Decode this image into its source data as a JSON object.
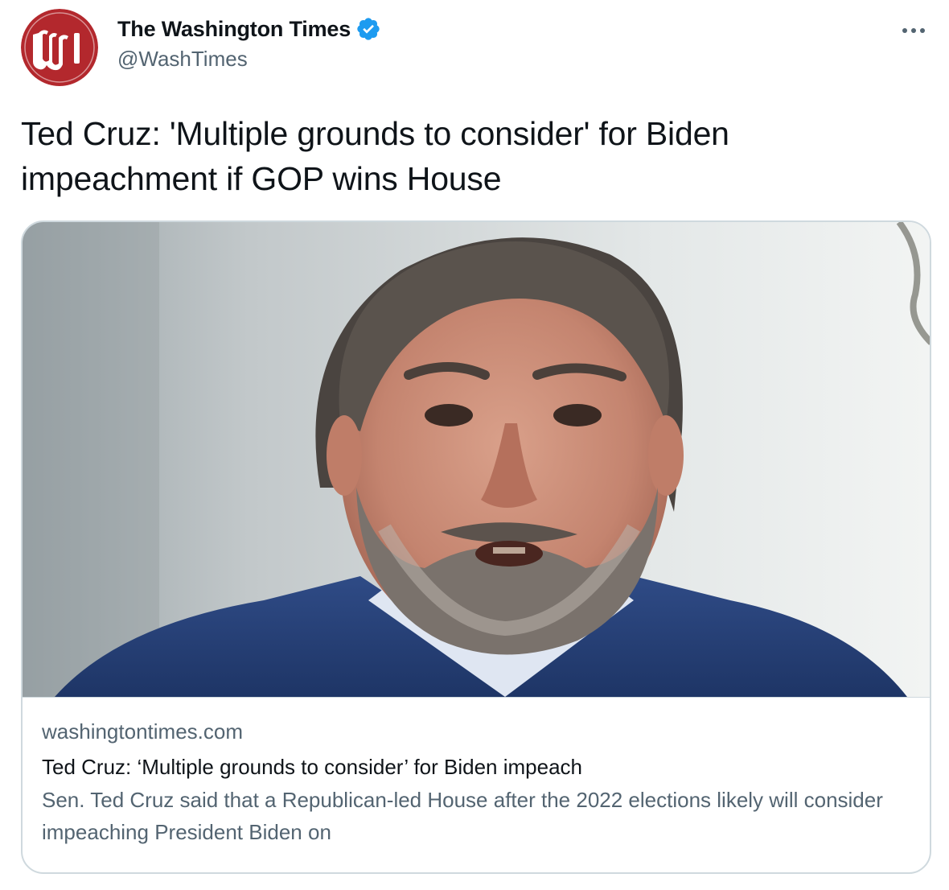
{
  "author": {
    "display_name": "The Washington Times",
    "handle": "@WashTimes",
    "verified": true,
    "avatar_icon": "washington-times-w-logo",
    "avatar_color": "#b3282d"
  },
  "more_icon": "ellipsis-icon",
  "tweet": {
    "text": "Ted Cruz: 'Multiple grounds to consider' for Biden impeachment if GOP wins House"
  },
  "card": {
    "image_icon": "article-photo",
    "domain": "washingtontimes.com",
    "title": "Ted Cruz: ‘Multiple grounds to consider’ for Biden impeach",
    "description": "Sen. Ted Cruz said that a Republican-led House after the 2022 elections likely will consider impeaching President Biden on"
  },
  "colors": {
    "verified_blue": "#1d9bf0",
    "text_primary": "#0f1419",
    "text_secondary": "#536471",
    "border": "#cfd9de"
  }
}
